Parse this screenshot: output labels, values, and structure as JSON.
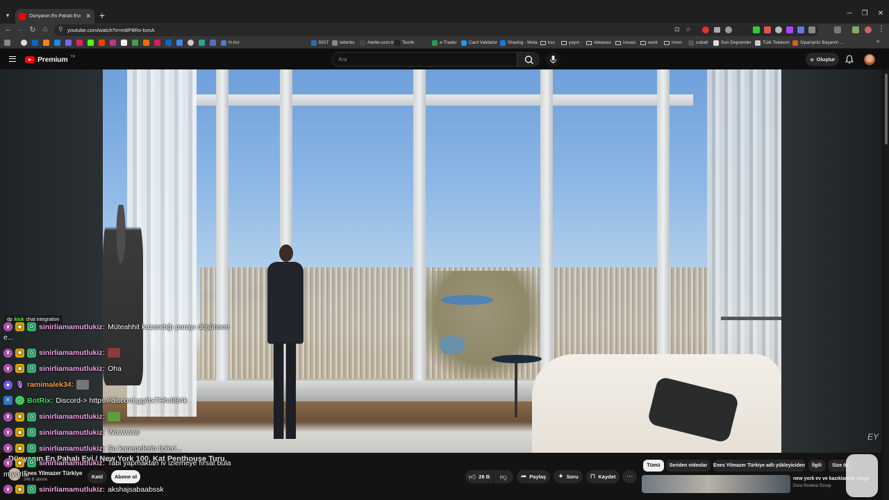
{
  "browser": {
    "tab_title": "Dünyanın En Pahalı Evi / N",
    "url": "youtube.com/watch?v=m8P8Ro-txmA",
    "bookmarks": [
      {
        "label": "H Arz",
        "color": "#4a7bd0"
      },
      {
        "label": "BIST",
        "color": "#2b6cb0"
      },
      {
        "label": "letterbx",
        "color": "#7d8a99"
      },
      {
        "label": "Aletler.com.tr",
        "color": "#444444"
      },
      {
        "label": "Teorik",
        "color": "#222222"
      },
      {
        "label": "e-Trader",
        "color": "#2e9a4e"
      },
      {
        "label": "Card Validator",
        "color": "#1d9bf0"
      },
      {
        "label": "Sharing - Meta",
        "color": "#1877f2"
      },
      {
        "label": "kss",
        "folder": true
      },
      {
        "label": "yayın",
        "folder": true
      },
      {
        "label": "releases",
        "folder": true
      },
      {
        "label": "issues",
        "folder": true
      },
      {
        "label": "work",
        "folder": true
      },
      {
        "label": "mmo",
        "folder": true
      },
      {
        "label": "cobalt",
        "color": "#555555"
      },
      {
        "label": "Son Depremler",
        "color": "#dddddd"
      },
      {
        "label": "Türk Telekom",
        "color": "#cccccc"
      },
      {
        "label": "Siparişiniz Başarılı! ...",
        "color": "#e05a2a"
      }
    ]
  },
  "youtube": {
    "logo_text": "Premium",
    "logo_badge": "TR",
    "search_placeholder": "Ara",
    "create_label": "Oluştur"
  },
  "chat": {
    "integration_label_prefix": "dp",
    "integration_label_k": "kick",
    "integration_label_suffix": "chat integration",
    "messages": [
      {
        "user": "sinirliamamutlukiz",
        "text": "Müteahhit kazandığı parayı düşünsen",
        "badges": [
          "sub",
          "crown",
          "g"
        ],
        "color": "pink"
      },
      {
        "user": "",
        "text": "e...",
        "badges": [],
        "color": "pink"
      },
      {
        "user": "sinirliamamutlukiz",
        "text": "",
        "badges": [
          "sub",
          "crown",
          "g"
        ],
        "color": "pink",
        "emote": "#8a3b3b"
      },
      {
        "user": "sinirliamamutlukiz",
        "text": "Oha",
        "badges": [
          "sub",
          "crown",
          "g"
        ],
        "color": "pink"
      },
      {
        "user": "ramimalek34",
        "text": "",
        "badges": [
          "mod",
          "mic"
        ],
        "color": "orange",
        "emote": "#777777"
      },
      {
        "user": "BotRix",
        "text": "Discord-> https://discord.gg/4xTHhr88Ak",
        "badges": [
          "bot",
          "check"
        ],
        "color": "green"
      },
      {
        "user": "sinirliamamutlukiz",
        "text": "",
        "badges": [
          "sub",
          "crown",
          "g"
        ],
        "color": "pink",
        "emote": "#5c9d3e"
      },
      {
        "user": "sinirliamamutlukiz",
        "text": "Wowwww",
        "badges": [
          "sub",
          "crown",
          "g"
        ],
        "color": "pink"
      },
      {
        "user": "sinirliamamutlukiz",
        "text": "Şu kanepelerin tipleri...",
        "badges": [
          "sub",
          "crown",
          "g"
        ],
        "color": "pink"
      },
      {
        "user": "sinirliamamutlukiz",
        "text": "Tabi yapmaktan iv izlemeye fırsat bula",
        "badges": [
          "sub",
          "crown",
          "g"
        ],
        "color": "pink"
      },
      {
        "user": "",
        "text": "mıyorlar",
        "badges": [],
        "color": "pink"
      },
      {
        "user": "sinirliamamutlukiz",
        "text": "akshajsabaabssk",
        "badges": [
          "sub",
          "crown",
          "g"
        ],
        "color": "pink"
      }
    ]
  },
  "video": {
    "title": "Dünyanın En Pahalı Evi / New York 100. Kat Penthouse Turu",
    "channel": "Enes Yilmazer Türkiye",
    "subscribers": "346 B abone",
    "join_label": "Katıl",
    "subscribe_label": "Abone ol",
    "likes": "26 B",
    "share_label": "Paylaş",
    "ask_label": "Soru",
    "save_label": "Kaydet",
    "watermark": "EY"
  },
  "recommendations": {
    "chips": [
      "Tümü",
      "Seriden videolar",
      "Enes Yilmazer Türkiye adlı yükleyiciden",
      "İlgili",
      "Size öz"
    ],
    "first_title": "new york ev ve kazıklanma vlogu",
    "first_channel": "Dora Stratera Özsoy"
  },
  "colors": {
    "youtube_red": "#ff0000",
    "kick_green": "#53fc18"
  }
}
